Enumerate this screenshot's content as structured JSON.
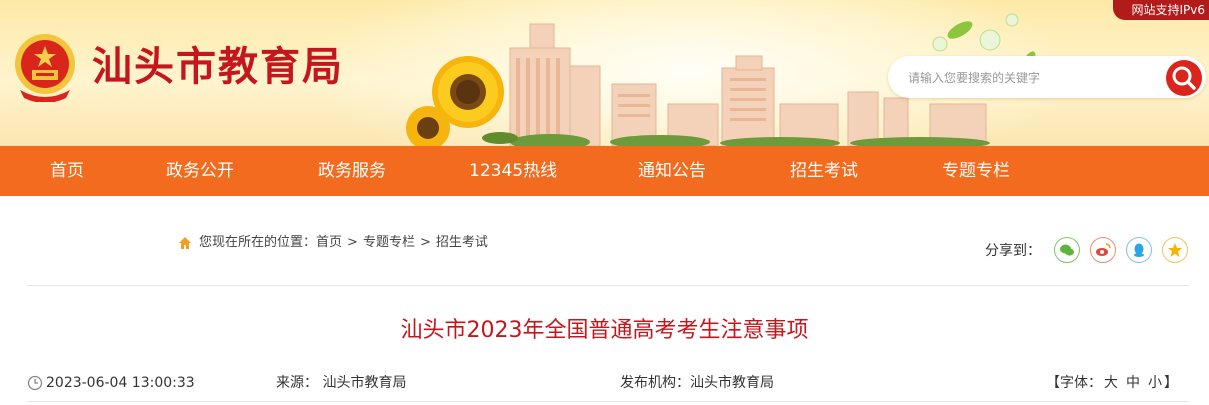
{
  "header": {
    "site_title": "汕头市教育局",
    "ipv6_badge": "网站支持IPv6",
    "search_placeholder": "请输入您要搜索的关键字"
  },
  "nav": {
    "items": [
      "首页",
      "政务公开",
      "政务服务",
      "12345热线",
      "通知公告",
      "招生考试",
      "专题专栏"
    ]
  },
  "breadcrumb": {
    "prefix": "您现在所在的位置：",
    "items": [
      "首页",
      "专题专栏",
      "招生考试"
    ],
    "separator": ">"
  },
  "share": {
    "label": "分享到：",
    "icons": [
      "wechat-icon",
      "weibo-icon",
      "qq-icon",
      "qzone-icon"
    ]
  },
  "article": {
    "title": "汕头市2023年全国普通高考考生注意事项",
    "datetime": "2023-06-04 13:00:33",
    "source_label": "来源：",
    "source_value": "汕头市教育局",
    "publisher_label": "发布机构：",
    "publisher_value": "汕头市教育局",
    "font_size_open": "【字体：",
    "font_large": "大",
    "font_medium": "中",
    "font_small": "小",
    "font_size_close": "】"
  },
  "colors": {
    "brand_red": "#c4161c",
    "nav_orange": "#f26b1f",
    "search_button": "#d9251c"
  }
}
